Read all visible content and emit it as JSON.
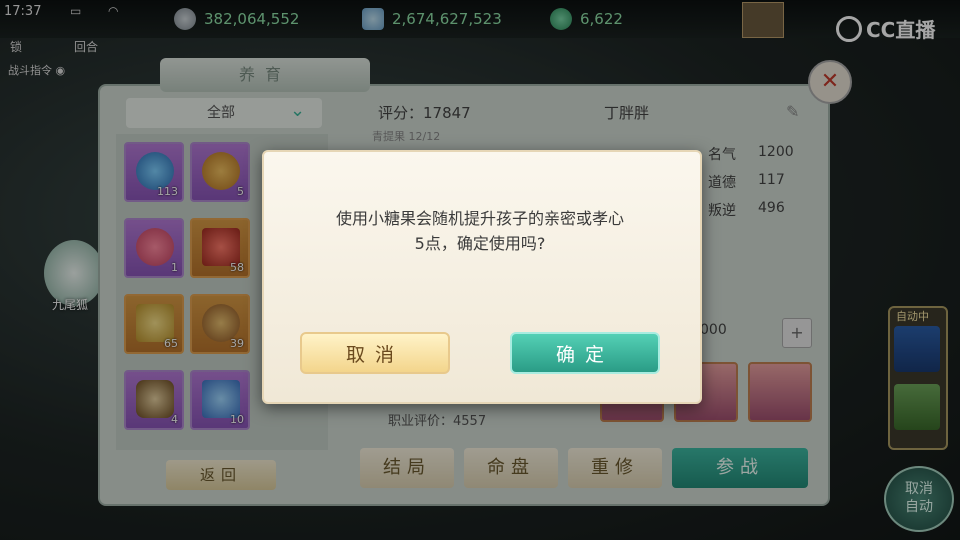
{
  "status": {
    "time": "17:37"
  },
  "currency": {
    "silver": "382,064,552",
    "gold": "2,674,627,523",
    "jade": "6,622"
  },
  "hud": {
    "small_left1": "锁",
    "small_left2": "回合",
    "battle_cmd": "战斗指令"
  },
  "logo": {
    "text": "CC直播"
  },
  "panel": {
    "title": "养育",
    "filter": "全部",
    "items": [
      {
        "count": "113",
        "color": "purple"
      },
      {
        "count": "5",
        "color": "purple"
      },
      {
        "count": "1",
        "color": "purple"
      },
      {
        "count": "58",
        "color": "orange"
      },
      {
        "count": "65",
        "color": "orange"
      },
      {
        "count": "39",
        "color": "orange"
      },
      {
        "count": "4",
        "color": "purple"
      },
      {
        "count": "10",
        "color": "purple"
      }
    ],
    "return_label": "返回"
  },
  "child": {
    "score_label": "评分：17847",
    "name": "丁胖胖",
    "subline": "青提果 12/12",
    "stats": [
      {
        "label": "名气",
        "value": "1200"
      },
      {
        "label": "道德",
        "value": "117"
      },
      {
        "label": "叛逆",
        "value": "496"
      }
    ],
    "input_value": "000",
    "career_label": "职业评价：4557"
  },
  "actions": {
    "ending": "结局",
    "fate": "命盘",
    "retrain": "重修",
    "battle": "参战"
  },
  "side": {
    "pet_label": "九尾狐",
    "auto_title": "自动中",
    "cancel_auto_line1": "取消",
    "cancel_auto_line2": "自动"
  },
  "modal": {
    "line1": "使用小糖果会随机提升孩子的亲密或孝心",
    "line2": "5点，确定使用吗?",
    "cancel": "取消",
    "ok": "确定"
  },
  "colors": {
    "accent": "#2a9c86",
    "cancel_btn": "#f3d58c",
    "currency_text": "#8fe0a8"
  }
}
